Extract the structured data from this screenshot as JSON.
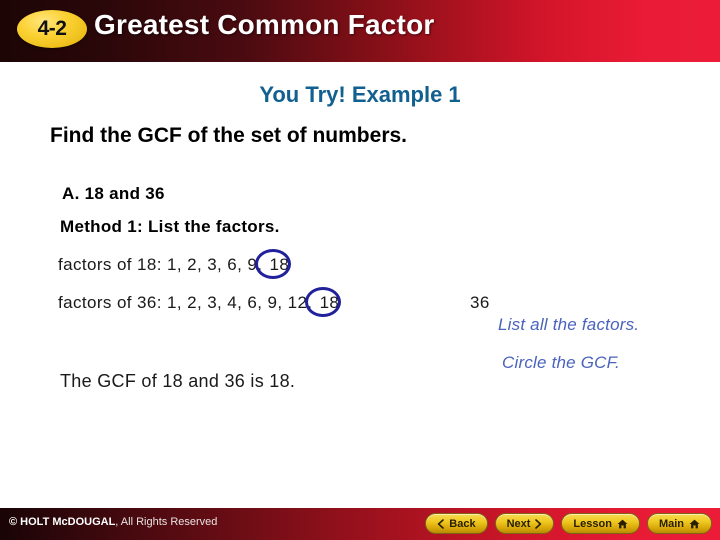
{
  "header": {
    "lesson_number": "4-2",
    "title": "Greatest Common Factor"
  },
  "slide": {
    "example_heading": "You Try! Example 1",
    "instruction": "Find the GCF of the set of numbers.",
    "part_label": "A.  18 and 36",
    "method_label": "Method 1:  List the factors.",
    "factors_18": {
      "prefix": "factors of 18:  1,  2,  3,  6,  9,",
      "circled_value": "18"
    },
    "factors_36": {
      "prefix": "factors of 36:  1,  2,  3,  4,  6,  9,  12,",
      "circled_value": "18",
      "trailing": "36"
    },
    "annotations": {
      "list_all": "List all the factors.",
      "circle_gcf": "Circle the GCF."
    },
    "conclusion": "The GCF of 18 and 36 is 18."
  },
  "footer": {
    "copyright_brand": "© HOLT McDOUGAL",
    "copyright_rest": ", All Rights Reserved",
    "nav_buttons": [
      {
        "label": "Back",
        "icon": "chevron-left-icon"
      },
      {
        "label": "Next",
        "icon": "chevron-right-icon"
      },
      {
        "label": "Lesson",
        "icon": "home-icon"
      },
      {
        "label": "Main",
        "icon": "home-icon"
      }
    ]
  },
  "colors": {
    "header_red": "#ec1c38",
    "header_dark": "#1c0506",
    "badge_gold": "#fbd234",
    "heading_blue": "#11608f",
    "annotation_blue": "#4a63bd",
    "circle_blue": "#21219c",
    "button_gold": "#efc920"
  }
}
